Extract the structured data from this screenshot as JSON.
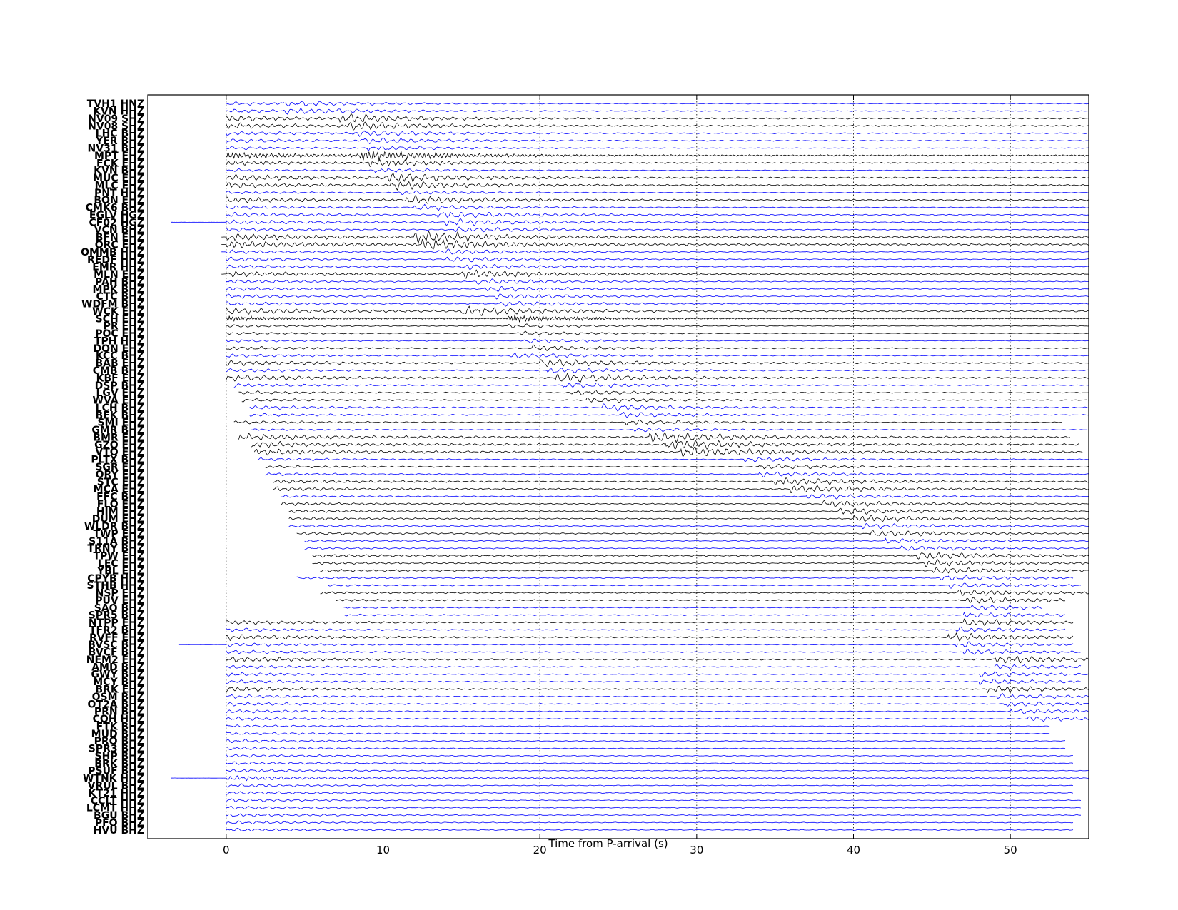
{
  "chart_data": {
    "type": "line",
    "xlabel": "Time from P-arrival (s)",
    "xlim": [
      -5,
      55
    ],
    "xticks": [
      0,
      10,
      20,
      30,
      40,
      50
    ],
    "grid": true,
    "colors": {
      "blue": "#0000ff",
      "black": "#000000"
    },
    "series": [
      {
        "name": "TVH1 HNZ",
        "color": "blue",
        "start": 0.0,
        "end": 55,
        "s_arrival": 3.6,
        "amp": 0.35,
        "dom": 0.6
      },
      {
        "name": "KVN HHZ",
        "color": "blue",
        "start": 0.0,
        "end": 55,
        "s_arrival": 3.6,
        "amp": 0.4,
        "dom": 0.6
      },
      {
        "name": "NV09 SHZ",
        "color": "black",
        "start": 0.0,
        "end": 55,
        "s_arrival": 7.2,
        "amp": 0.6,
        "dom": 0.5
      },
      {
        "name": "NV08 SHZ",
        "color": "black",
        "start": 0.0,
        "end": 55,
        "s_arrival": 7.5,
        "amp": 0.6,
        "dom": 0.5
      },
      {
        "name": "LHC BHZ",
        "color": "blue",
        "start": 0.0,
        "end": 55,
        "s_arrival": 8.0,
        "amp": 0.45,
        "dom": 0.6
      },
      {
        "name": "YER BHZ",
        "color": "blue",
        "start": 0.0,
        "end": 55,
        "s_arrival": 8.5,
        "amp": 0.45,
        "dom": 0.6
      },
      {
        "name": "NV31 BHZ",
        "color": "blue",
        "start": 0.0,
        "end": 55,
        "s_arrival": 9.0,
        "amp": 0.35,
        "dom": 0.6
      },
      {
        "name": "MPT EHZ",
        "color": "black",
        "start": 0.0,
        "end": 55,
        "s_arrival": 8.5,
        "amp": 0.7,
        "dom": 0.25
      },
      {
        "name": "FCK EHZ",
        "color": "black",
        "start": 0.0,
        "end": 55,
        "s_arrival": 9.0,
        "amp": 0.5,
        "dom": 0.4
      },
      {
        "name": "KVN BHZ",
        "color": "blue",
        "start": 0.0,
        "end": 55,
        "s_arrival": 9.5,
        "amp": 0.3,
        "dom": 0.6
      },
      {
        "name": "MUC EHZ",
        "color": "black",
        "start": 0.0,
        "end": 55,
        "s_arrival": 10.0,
        "amp": 0.7,
        "dom": 0.5
      },
      {
        "name": "MLC EHZ",
        "color": "black",
        "start": 0.0,
        "end": 55,
        "s_arrival": 10.5,
        "amp": 0.6,
        "dom": 0.5
      },
      {
        "name": "PNT HHZ",
        "color": "blue",
        "start": 0.0,
        "end": 55,
        "s_arrival": 11.0,
        "amp": 0.3,
        "dom": 0.6
      },
      {
        "name": "BON EHZ",
        "color": "black",
        "start": 0.0,
        "end": 55,
        "s_arrival": 11.5,
        "amp": 0.6,
        "dom": 0.5
      },
      {
        "name": "CMK6 BHZ",
        "color": "blue",
        "start": 0.0,
        "end": 55,
        "s_arrival": 12.0,
        "amp": 0.4,
        "dom": 0.6
      },
      {
        "name": "EGLV HGZ",
        "color": "blue",
        "start": 0.0,
        "end": 55,
        "s_arrival": 13.5,
        "amp": 0.5,
        "dom": 0.6
      },
      {
        "name": "CF02 HGZ",
        "color": "blue",
        "start": -3.5,
        "end": 55,
        "s_arrival": 14.0,
        "amp": 0.5,
        "dom": 0.6
      },
      {
        "name": "VCN BHZ",
        "color": "blue",
        "start": 0.0,
        "end": 55,
        "s_arrival": 14.5,
        "amp": 0.4,
        "dom": 0.6
      },
      {
        "name": "BFN EHZ",
        "color": "black",
        "start": -0.3,
        "end": 55,
        "s_arrival": 12.0,
        "amp": 0.8,
        "dom": 0.45
      },
      {
        "name": "ORC EHZ",
        "color": "black",
        "start": -0.3,
        "end": 55,
        "s_arrival": 12.5,
        "amp": 0.8,
        "dom": 0.45
      },
      {
        "name": "OMMB HHZ",
        "color": "blue",
        "start": -0.3,
        "end": 55,
        "s_arrival": 13.5,
        "amp": 0.4,
        "dom": 0.6
      },
      {
        "name": "REDF HHZ",
        "color": "blue",
        "start": 0.0,
        "end": 55,
        "s_arrival": 14.0,
        "amp": 0.4,
        "dom": 0.6
      },
      {
        "name": "EMR HHZ",
        "color": "blue",
        "start": 0.0,
        "end": 55,
        "s_arrival": 15.0,
        "amp": 0.4,
        "dom": 0.6
      },
      {
        "name": "MLN EHZ",
        "color": "black",
        "start": -0.3,
        "end": 55,
        "s_arrival": 15.0,
        "amp": 0.6,
        "dom": 0.45
      },
      {
        "name": "PAH BHZ",
        "color": "blue",
        "start": 0.0,
        "end": 55,
        "s_arrival": 16.0,
        "amp": 0.4,
        "dom": 0.6
      },
      {
        "name": "MPK BHZ",
        "color": "blue",
        "start": 0.0,
        "end": 55,
        "s_arrival": 16.5,
        "amp": 0.4,
        "dom": 0.6
      },
      {
        "name": "CTC BHZ",
        "color": "blue",
        "start": 0.0,
        "end": 55,
        "s_arrival": 17.0,
        "amp": 0.4,
        "dom": 0.6
      },
      {
        "name": "WDFM BHZ",
        "color": "blue",
        "start": 0.0,
        "end": 55,
        "s_arrival": 17.5,
        "amp": 0.4,
        "dom": 0.6
      },
      {
        "name": "WCK EHZ",
        "color": "black",
        "start": 0.0,
        "end": 55,
        "s_arrival": 15.0,
        "amp": 0.7,
        "dom": 0.55
      },
      {
        "name": "SCH EHZ",
        "color": "black",
        "start": 0.0,
        "end": 55,
        "s_arrival": 18.0,
        "amp": 0.5,
        "dom": 0.2
      },
      {
        "name": "PR EHZ",
        "color": "black",
        "start": 0.0,
        "end": 55,
        "s_arrival": 18.0,
        "amp": 0.3,
        "dom": 0.6
      },
      {
        "name": "POC EHZ",
        "color": "black",
        "start": 0.0,
        "end": 55,
        "s_arrival": 18.5,
        "amp": 0.3,
        "dom": 0.6
      },
      {
        "name": "TPH HHZ",
        "color": "blue",
        "start": 0.0,
        "end": 55,
        "s_arrival": 19.0,
        "amp": 0.3,
        "dom": 0.6
      },
      {
        "name": "DON EHZ",
        "color": "black",
        "start": 0.0,
        "end": 55,
        "s_arrival": 19.5,
        "amp": 0.4,
        "dom": 0.6
      },
      {
        "name": "KCC BHZ",
        "color": "blue",
        "start": 0.0,
        "end": 55,
        "s_arrival": 18.0,
        "amp": 0.4,
        "dom": 0.6
      },
      {
        "name": "BAB EHZ",
        "color": "black",
        "start": 0.0,
        "end": 55,
        "s_arrival": 20.0,
        "amp": 0.6,
        "dom": 0.55
      },
      {
        "name": "CMB BHZ",
        "color": "blue",
        "start": 0.0,
        "end": 55,
        "s_arrival": 20.5,
        "amp": 0.4,
        "dom": 0.6
      },
      {
        "name": "KBF EHZ",
        "color": "black",
        "start": 0.0,
        "end": 55,
        "s_arrival": 21.0,
        "amp": 0.7,
        "dom": 0.55
      },
      {
        "name": "DSP BHZ",
        "color": "blue",
        "start": 0.5,
        "end": 55,
        "s_arrival": 21.5,
        "amp": 0.4,
        "dom": 0.6
      },
      {
        "name": "LGV EHZ",
        "color": "black",
        "start": 0.8,
        "end": 55,
        "s_arrival": 22.0,
        "amp": 0.4,
        "dom": 0.6
      },
      {
        "name": "WVA EHZ",
        "color": "black",
        "start": 1.0,
        "end": 55,
        "s_arrival": 23.0,
        "amp": 0.4,
        "dom": 0.6
      },
      {
        "name": "LCH BHZ",
        "color": "blue",
        "start": 1.5,
        "end": 55,
        "s_arrival": 24.0,
        "amp": 0.5,
        "dom": 0.6
      },
      {
        "name": "BEK BHZ",
        "color": "blue",
        "start": 1.5,
        "end": 55,
        "s_arrival": 25.0,
        "amp": 0.4,
        "dom": 0.6
      },
      {
        "name": "SMI EHZ",
        "color": "black",
        "start": 0.5,
        "end": 53.3,
        "s_arrival": 25.5,
        "amp": 0.4,
        "dom": 0.6
      },
      {
        "name": "GMR BHZ",
        "color": "blue",
        "start": 1.5,
        "end": 55,
        "s_arrival": 26.0,
        "amp": 0.3,
        "dom": 0.6
      },
      {
        "name": "BMR EHZ",
        "color": "black",
        "start": 0.8,
        "end": 53.8,
        "s_arrival": 27.0,
        "amp": 0.8,
        "dom": 0.5
      },
      {
        "name": "GZO EHZ",
        "color": "black",
        "start": 1.6,
        "end": 54.4,
        "s_arrival": 28.0,
        "amp": 0.8,
        "dom": 0.5
      },
      {
        "name": "VTO EHZ",
        "color": "black",
        "start": 1.8,
        "end": 54.6,
        "s_arrival": 29.0,
        "amp": 0.8,
        "dom": 0.5
      },
      {
        "name": "PLTX BHZ",
        "color": "blue",
        "start": 2.0,
        "end": 55,
        "s_arrival": 33.0,
        "amp": 0.4,
        "dom": 0.6
      },
      {
        "name": "SGR EHZ",
        "color": "black",
        "start": 2.5,
        "end": 55,
        "s_arrival": 34.0,
        "amp": 0.4,
        "dom": 0.6
      },
      {
        "name": "QRY EHZ",
        "color": "blue",
        "start": 2.5,
        "end": 55,
        "s_arrival": 34.0,
        "amp": 0.4,
        "dom": 0.6
      },
      {
        "name": "STC EHZ",
        "color": "black",
        "start": 3.0,
        "end": 55,
        "s_arrival": 35.0,
        "amp": 0.6,
        "dom": 0.5
      },
      {
        "name": "MCA EHZ",
        "color": "black",
        "start": 3.0,
        "end": 55,
        "s_arrival": 36.0,
        "amp": 0.6,
        "dom": 0.5
      },
      {
        "name": "FFC BHZ",
        "color": "blue",
        "start": 3.5,
        "end": 55,
        "s_arrival": 37.0,
        "amp": 0.4,
        "dom": 0.6
      },
      {
        "name": "FLO EHZ",
        "color": "black",
        "start": 3.5,
        "end": 55,
        "s_arrival": 38.0,
        "amp": 0.5,
        "dom": 0.5
      },
      {
        "name": "HIM EHZ",
        "color": "black",
        "start": 4.0,
        "end": 55,
        "s_arrival": 39.0,
        "amp": 0.5,
        "dom": 0.5
      },
      {
        "name": "DUM EHZ",
        "color": "black",
        "start": 4.0,
        "end": 55,
        "s_arrival": 40.0,
        "amp": 0.5,
        "dom": 0.5
      },
      {
        "name": "WLDR BHZ",
        "color": "blue",
        "start": 4.0,
        "end": 55,
        "s_arrival": 40.5,
        "amp": 0.4,
        "dom": 0.6
      },
      {
        "name": "TWP EHZ",
        "color": "black",
        "start": 4.5,
        "end": 55,
        "s_arrival": 41.0,
        "amp": 0.5,
        "dom": 0.55
      },
      {
        "name": "S11A BHZ",
        "color": "blue",
        "start": 5.0,
        "end": 55,
        "s_arrival": 42.0,
        "amp": 0.4,
        "dom": 0.6
      },
      {
        "name": "TRNY BHZ",
        "color": "blue",
        "start": 5.0,
        "end": 55,
        "s_arrival": 43.0,
        "amp": 0.4,
        "dom": 0.6
      },
      {
        "name": "TPW EHZ",
        "color": "black",
        "start": 5.5,
        "end": 55,
        "s_arrival": 44.0,
        "amp": 0.6,
        "dom": 0.5
      },
      {
        "name": "LEC EHZ",
        "color": "black",
        "start": 5.5,
        "end": 55,
        "s_arrival": 44.5,
        "amp": 0.5,
        "dom": 0.5
      },
      {
        "name": "YBL EHZ",
        "color": "black",
        "start": 6.0,
        "end": 55,
        "s_arrival": 45.0,
        "amp": 0.5,
        "dom": 0.5
      },
      {
        "name": "CPYB HHZ",
        "color": "blue",
        "start": 4.5,
        "end": 54.0,
        "s_arrival": 45.5,
        "amp": 0.4,
        "dom": 0.6
      },
      {
        "name": "STHB HHZ",
        "color": "blue",
        "start": 6.5,
        "end": 54.5,
        "s_arrival": 46.0,
        "amp": 0.4,
        "dom": 0.6
      },
      {
        "name": "NSP EHZ",
        "color": "black",
        "start": 6.0,
        "end": 55,
        "s_arrival": 46.5,
        "amp": 0.5,
        "dom": 0.5
      },
      {
        "name": "PUV EHZ",
        "color": "black",
        "start": 7.0,
        "end": 53.5,
        "s_arrival": 47.0,
        "amp": 0.5,
        "dom": 0.5
      },
      {
        "name": "SAO BHZ",
        "color": "blue",
        "start": 7.5,
        "end": 52.0,
        "s_arrival": 47.5,
        "amp": 0.4,
        "dom": 0.6
      },
      {
        "name": "SPR5 BHZ",
        "color": "blue",
        "start": 7.5,
        "end": 53.5,
        "s_arrival": 47.0,
        "amp": 0.4,
        "dom": 0.6
      },
      {
        "name": "NTPP EHZ",
        "color": "black",
        "start": 0.0,
        "end": 54.0,
        "s_arrival": 47.0,
        "amp": 0.5,
        "dom": 0.5
      },
      {
        "name": "TFR2 BHZ",
        "color": "blue",
        "start": 0.0,
        "end": 53.5,
        "s_arrival": 46.5,
        "amp": 0.4,
        "dom": 0.6
      },
      {
        "name": "RVFF EHZ",
        "color": "black",
        "start": 0.0,
        "end": 54.0,
        "s_arrival": 46.0,
        "amp": 0.6,
        "dom": 0.5
      },
      {
        "name": "BVSC BHZ",
        "color": "blue",
        "start": -3.0,
        "end": 54.0,
        "s_arrival": 46.5,
        "amp": 0.4,
        "dom": 0.6
      },
      {
        "name": "BVCF BHZ",
        "color": "blue",
        "start": 0.0,
        "end": 54.5,
        "s_arrival": 47.0,
        "amp": 0.4,
        "dom": 0.6
      },
      {
        "name": "NEM2 EHZ",
        "color": "black",
        "start": 0.0,
        "end": 55,
        "s_arrival": 49.0,
        "amp": 0.6,
        "dom": 0.5
      },
      {
        "name": "AMD BHZ",
        "color": "blue",
        "start": 0.0,
        "end": 54.5,
        "s_arrival": 49.0,
        "amp": 0.4,
        "dom": 0.6
      },
      {
        "name": "GWY BHZ",
        "color": "blue",
        "start": 0.0,
        "end": 55,
        "s_arrival": 48.0,
        "amp": 0.4,
        "dom": 0.6
      },
      {
        "name": "MCY BHZ",
        "color": "blue",
        "start": 0.0,
        "end": 54.5,
        "s_arrival": 48.0,
        "amp": 0.4,
        "dom": 0.6
      },
      {
        "name": "BRK EHZ",
        "color": "black",
        "start": 0.0,
        "end": 55,
        "s_arrival": 48.5,
        "amp": 0.5,
        "dom": 0.5
      },
      {
        "name": "OSM BHZ",
        "color": "blue",
        "start": 0.0,
        "end": 55,
        "s_arrival": 49.0,
        "amp": 0.4,
        "dom": 0.6
      },
      {
        "name": "OT2A BHZ",
        "color": "blue",
        "start": 0.0,
        "end": 55,
        "s_arrival": 49.5,
        "amp": 0.4,
        "dom": 0.6
      },
      {
        "name": "PRN BHZ",
        "color": "blue",
        "start": 0.0,
        "end": 55,
        "s_arrival": 50.0,
        "amp": 0.4,
        "dom": 0.6
      },
      {
        "name": "CQH HHZ",
        "color": "blue",
        "start": 0.0,
        "end": 55,
        "s_arrival": 51.0,
        "amp": 0.4,
        "dom": 0.6
      },
      {
        "name": "FTK BHZ",
        "color": "blue",
        "start": 0.0,
        "end": 52.5,
        "s_arrival": 60,
        "amp": 0.3,
        "dom": 0.6
      },
      {
        "name": "MUD BHZ",
        "color": "blue",
        "start": 0.0,
        "end": 52.5,
        "s_arrival": 60,
        "amp": 0.35,
        "dom": 0.6
      },
      {
        "name": "PRO BHZ",
        "color": "blue",
        "start": 0.0,
        "end": 53.5,
        "s_arrival": 60,
        "amp": 0.35,
        "dom": 0.6
      },
      {
        "name": "SPR3 BHZ",
        "color": "blue",
        "start": 0.0,
        "end": 53.5,
        "s_arrival": 60,
        "amp": 0.35,
        "dom": 0.6
      },
      {
        "name": "SHP BHZ",
        "color": "blue",
        "start": 0.0,
        "end": 54.0,
        "s_arrival": 60,
        "amp": 0.35,
        "dom": 0.6
      },
      {
        "name": "BRK BHZ",
        "color": "blue",
        "start": 0.0,
        "end": 54.0,
        "s_arrival": 60,
        "amp": 0.35,
        "dom": 0.6
      },
      {
        "name": "PSUF BHZ",
        "color": "blue",
        "start": 0.0,
        "end": 55,
        "s_arrival": 60,
        "amp": 0.35,
        "dom": 0.6
      },
      {
        "name": "WTNK HHZ",
        "color": "blue",
        "start": -3.5,
        "end": 55,
        "s_arrival": 60,
        "amp": 0.5,
        "dom": 0.4
      },
      {
        "name": "VRUL BHZ",
        "color": "blue",
        "start": 0.0,
        "end": 54.0,
        "s_arrival": 60,
        "amp": 0.35,
        "dom": 0.6
      },
      {
        "name": "KT21 HHZ",
        "color": "blue",
        "start": 0.0,
        "end": 54.0,
        "s_arrival": 60,
        "amp": 0.35,
        "dom": 0.6
      },
      {
        "name": "CCLT HHZ",
        "color": "blue",
        "start": 0.0,
        "end": 54.5,
        "s_arrival": 60,
        "amp": 0.35,
        "dom": 0.6
      },
      {
        "name": "LCMT HHZ",
        "color": "blue",
        "start": 0.0,
        "end": 54.5,
        "s_arrival": 60,
        "amp": 0.35,
        "dom": 0.6
      },
      {
        "name": "BGU BHZ",
        "color": "blue",
        "start": 0.0,
        "end": 54.5,
        "s_arrival": 60,
        "amp": 0.35,
        "dom": 0.6
      },
      {
        "name": "PFO BHZ",
        "color": "blue",
        "start": 0.0,
        "end": 54.0,
        "s_arrival": 60,
        "amp": 0.35,
        "dom": 0.6
      },
      {
        "name": "HVU BHZ",
        "color": "blue",
        "start": 0.0,
        "end": 54.0,
        "s_arrival": 60,
        "amp": 0.35,
        "dom": 0.6
      }
    ]
  }
}
